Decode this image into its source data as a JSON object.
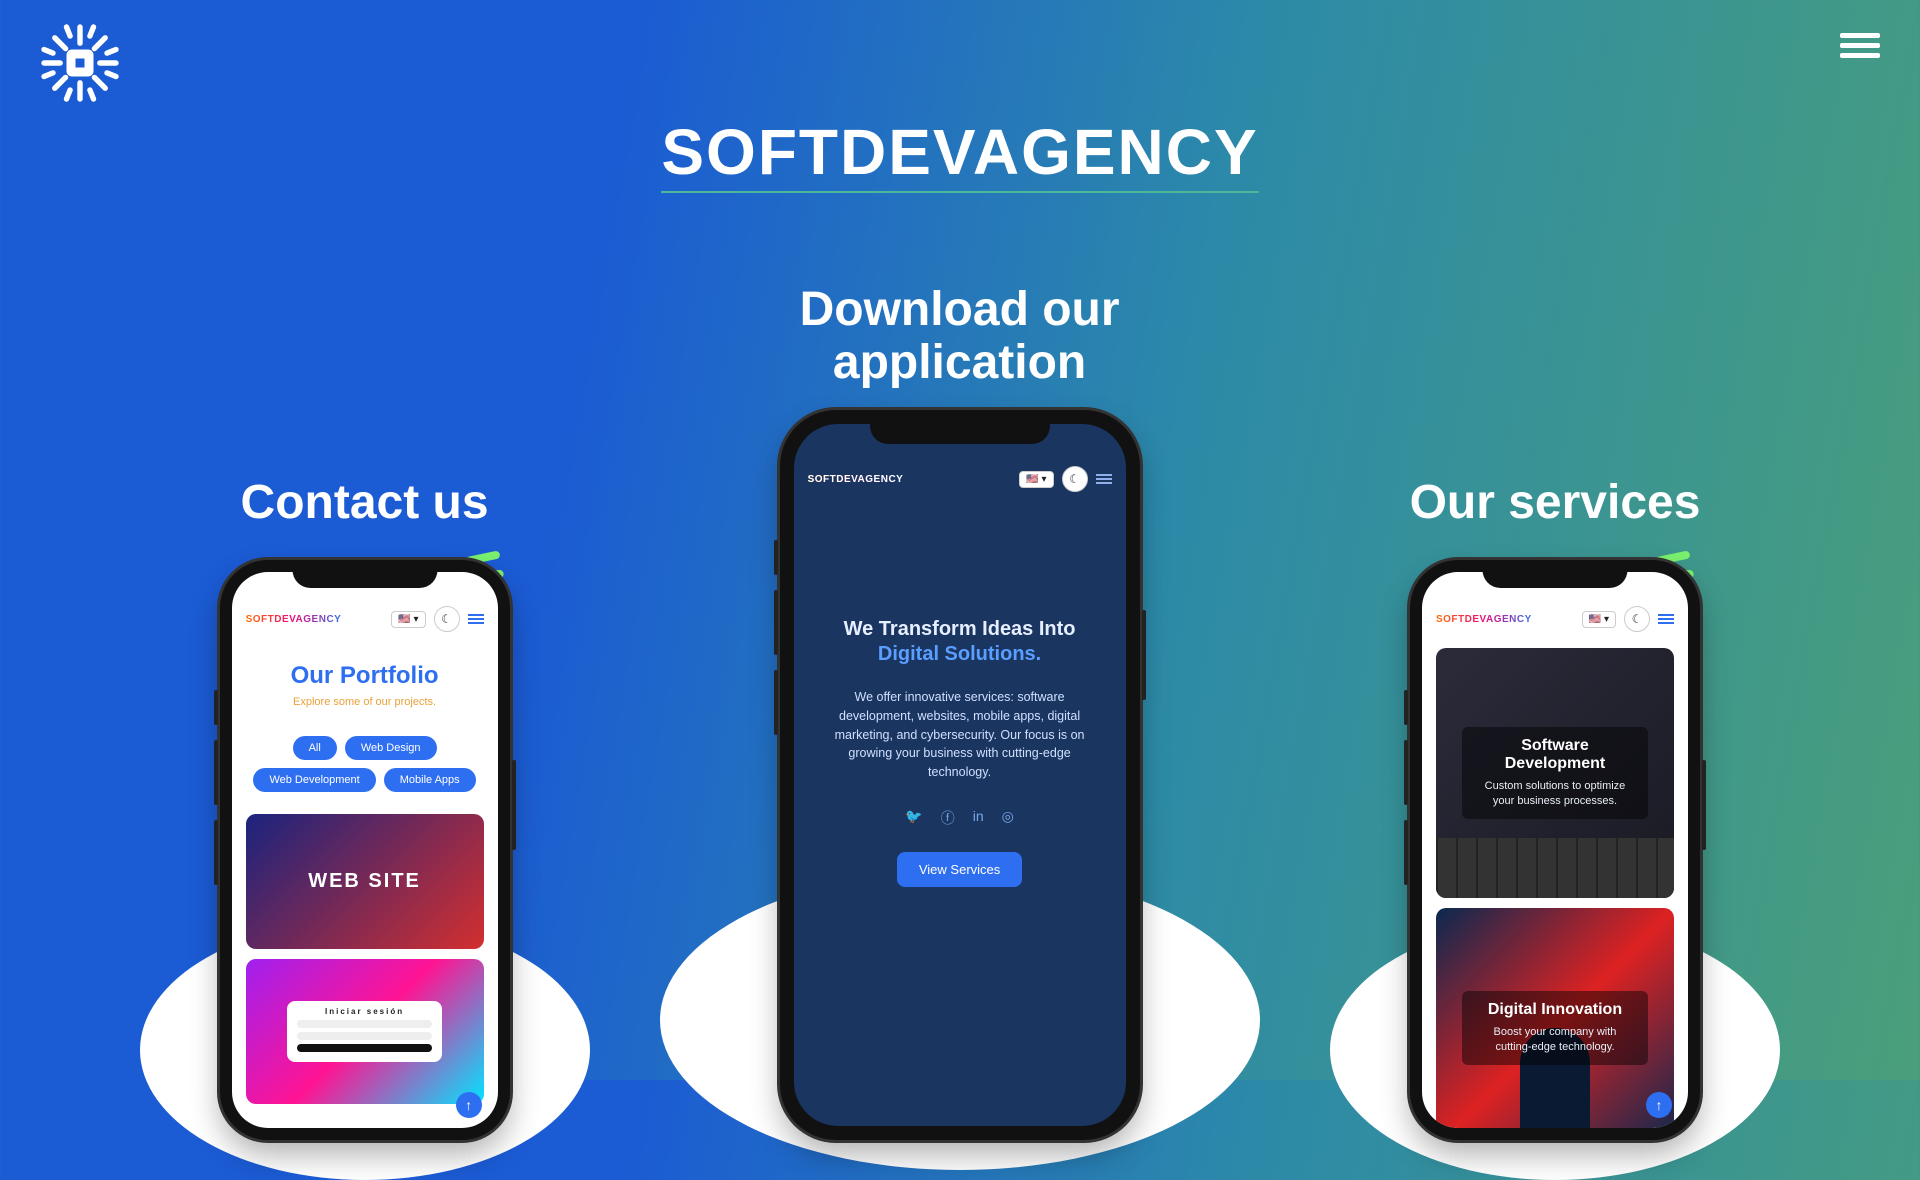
{
  "brand": "SOFTDEVAGENCY",
  "hamburger_label": "menu",
  "sections": {
    "left": {
      "title": "Contact us"
    },
    "center": {
      "title": "Download our application"
    },
    "right": {
      "title": "Our services"
    }
  },
  "mini_brand": "SOFTDEVAGENCY",
  "flag": "🇺🇸",
  "flag_caret": "▾",
  "dark_mode_icon": "☾",
  "portfolio": {
    "title": "Our Portfolio",
    "subtitle": "Explore some of our projects.",
    "filters": [
      "All",
      "Web Design",
      "Web Development",
      "Mobile Apps"
    ],
    "card1": "WEB SITE",
    "login_title": "Iniciar sesión"
  },
  "hero": {
    "line1": "We Transform Ideas Into",
    "line2": "Digital Solutions.",
    "body": "We offer innovative services: software development, websites, mobile apps, digital marketing, and cybersecurity. Our focus is on growing your business with cutting-edge technology.",
    "cta": "View Services"
  },
  "services": {
    "card1_title": "Software Development",
    "card1_body": "Custom solutions to optimize your business processes.",
    "card2_title": "Digital Innovation",
    "card2_body": "Boost your company with cutting-edge technology."
  },
  "fab": "↑",
  "social": {
    "tw": "🐦",
    "fb": "ⓕ",
    "in": "in",
    "ig": "◎"
  }
}
